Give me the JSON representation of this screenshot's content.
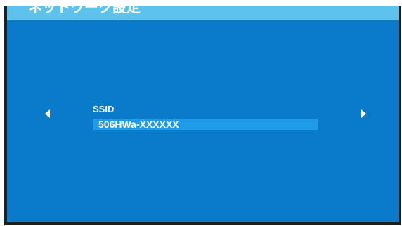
{
  "header": {
    "title": "ネットワーク設定"
  },
  "nav": {
    "prev_icon": "triangle-left",
    "next_icon": "triangle-right"
  },
  "field": {
    "label": "SSID",
    "value": "506HWa-XXXXXX"
  },
  "colors": {
    "background": "#0a7bca",
    "title_bar": "#5ec3ec",
    "selection": "#1f9bea",
    "text": "#ffffff"
  }
}
